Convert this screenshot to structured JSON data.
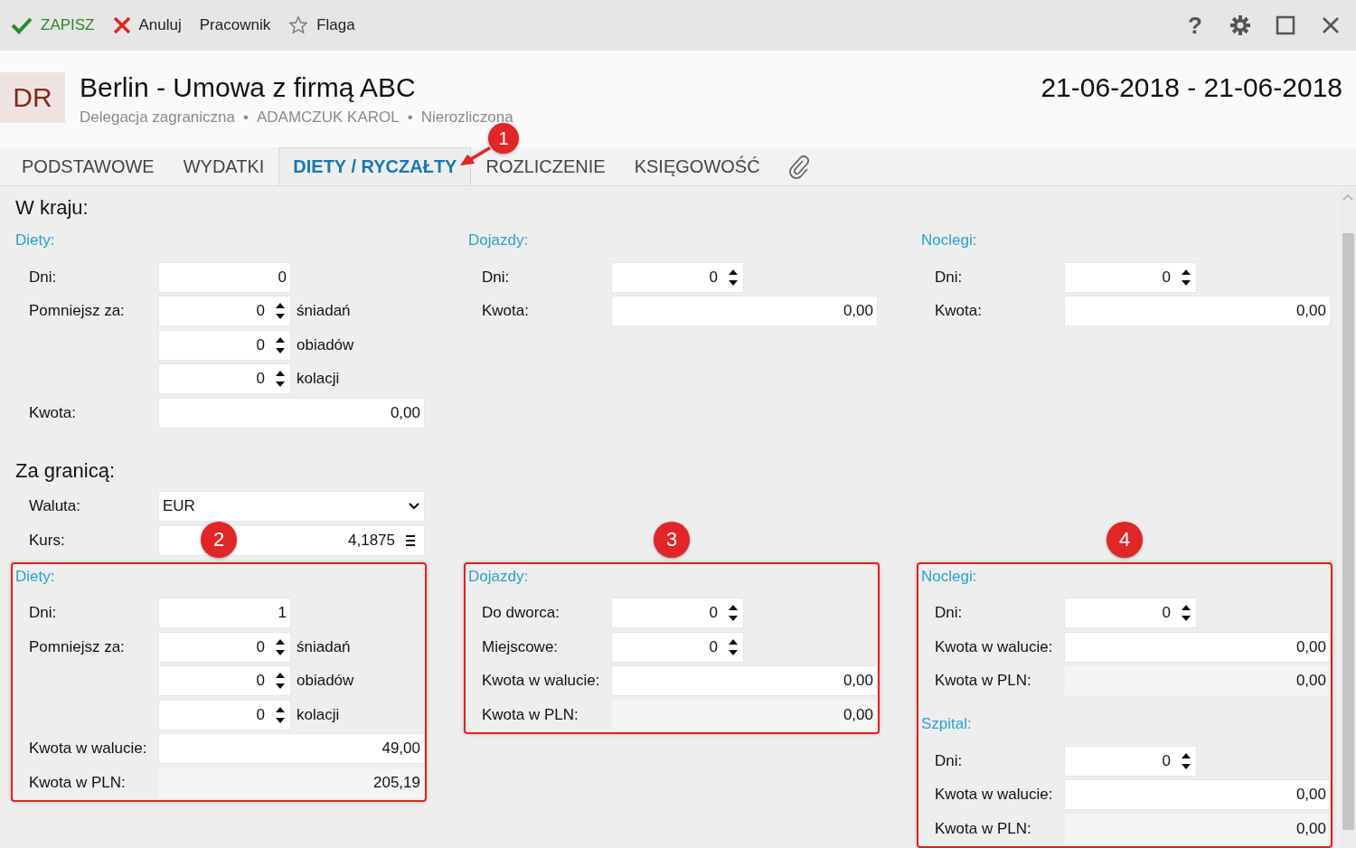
{
  "toolbar": {
    "actions": [
      {
        "kind": "save",
        "label": "ZAPISZ"
      },
      {
        "kind": "cancel",
        "label": "Anuluj"
      },
      {
        "kind": "plain",
        "label": "Pracownik"
      },
      {
        "kind": "flag",
        "label": "Flaga"
      }
    ],
    "window_controls": [
      {
        "kind": "help",
        "label": "?"
      },
      {
        "kind": "settings"
      },
      {
        "kind": "maximize"
      },
      {
        "kind": "close"
      }
    ]
  },
  "header": {
    "badge": "DR",
    "title": "Berlin - Umowa z firmą ABC",
    "meta": [
      "Delegacja zagraniczna",
      "ADAMCZUK KAROL",
      "Nierozliczona"
    ],
    "separator": "•",
    "dates": "21-06-2018 - 21-06-2018"
  },
  "tabs": [
    {
      "label": "PODSTAWOWE",
      "selected": false
    },
    {
      "label": "WYDATKI",
      "selected": false
    },
    {
      "label": "DIETY / RYCZAŁTY",
      "selected": true
    },
    {
      "label": "ROZLICZENIE",
      "selected": false
    },
    {
      "label": "KSIĘGOWOŚĆ",
      "selected": false
    }
  ],
  "tab_callout": "1",
  "domestic": {
    "title": "W kraju:",
    "panels": [
      {
        "highlighted": false,
        "blocks": [
          {
            "title": "Diety:",
            "rows": [
              {
                "kind": "number",
                "label": "Dni:",
                "value": "0"
              },
              {
                "kind": "spinner",
                "label": "Pomniejsz za:",
                "value": "0",
                "suffix": "śniadań"
              },
              {
                "kind": "spinner",
                "value": "0",
                "suffix": "obiadów"
              },
              {
                "kind": "spinner",
                "value": "0",
                "suffix": "kolacji"
              },
              {
                "kind": "amount",
                "label": "Kwota:",
                "value": "0,00"
              }
            ]
          }
        ]
      },
      {
        "highlighted": false,
        "blocks": [
          {
            "title": "Dojazdy:",
            "rows": [
              {
                "kind": "spinner",
                "label": "Dni:",
                "value": "0"
              },
              {
                "kind": "amount",
                "label": "Kwota:",
                "value": "0,00"
              }
            ]
          }
        ]
      },
      {
        "highlighted": false,
        "blocks": [
          {
            "title": "Noclegi:",
            "rows": [
              {
                "kind": "spinner",
                "label": "Dni:",
                "value": "0"
              },
              {
                "kind": "amount",
                "label": "Kwota:",
                "value": "0,00"
              }
            ]
          }
        ]
      }
    ]
  },
  "foreign": {
    "title": "Za granicą:",
    "rows": [
      {
        "kind": "select",
        "label": "Waluta:",
        "value": "EUR"
      },
      {
        "kind": "rate",
        "label": "Kurs:",
        "value": "4,1875"
      }
    ],
    "panels": [
      {
        "highlighted": true,
        "callout": "2",
        "blocks": [
          {
            "title": "Diety:",
            "rows": [
              {
                "kind": "number",
                "label": "Dni:",
                "value": "1"
              },
              {
                "kind": "spinner",
                "label": "Pomniejsz za:",
                "value": "0",
                "suffix": "śniadań"
              },
              {
                "kind": "spinner",
                "value": "0",
                "suffix": "obiadów"
              },
              {
                "kind": "spinner",
                "value": "0",
                "suffix": "kolacji"
              },
              {
                "kind": "amount",
                "label": "Kwota w walucie:",
                "value": "49,00"
              },
              {
                "kind": "readonly",
                "label": "Kwota w PLN:",
                "value": "205,19"
              }
            ]
          }
        ]
      },
      {
        "highlighted": true,
        "callout": "3",
        "blocks": [
          {
            "title": "Dojazdy:",
            "rows": [
              {
                "kind": "spinner",
                "label": "Do dworca:",
                "value": "0"
              },
              {
                "kind": "spinner",
                "label": "Miejscowe:",
                "value": "0"
              },
              {
                "kind": "amount",
                "label": "Kwota w walucie:",
                "value": "0,00"
              },
              {
                "kind": "readonly",
                "label": "Kwota w PLN:",
                "value": "0,00"
              }
            ]
          }
        ]
      },
      {
        "highlighted": true,
        "callout": "4",
        "blocks": [
          {
            "title": "Noclegi:",
            "rows": [
              {
                "kind": "spinner",
                "label": "Dni:",
                "value": "0"
              },
              {
                "kind": "amount",
                "label": "Kwota w walucie:",
                "value": "0,00"
              },
              {
                "kind": "readonly",
                "label": "Kwota w PLN:",
                "value": "0,00"
              }
            ]
          },
          {
            "title": "Szpital:",
            "rows": [
              {
                "kind": "spinner",
                "label": "Dni:",
                "value": "0"
              },
              {
                "kind": "amount",
                "label": "Kwota w walucie:",
                "value": "0,00"
              },
              {
                "kind": "readonly",
                "label": "Kwota w PLN:",
                "value": "0,00"
              }
            ]
          }
        ]
      }
    ]
  }
}
